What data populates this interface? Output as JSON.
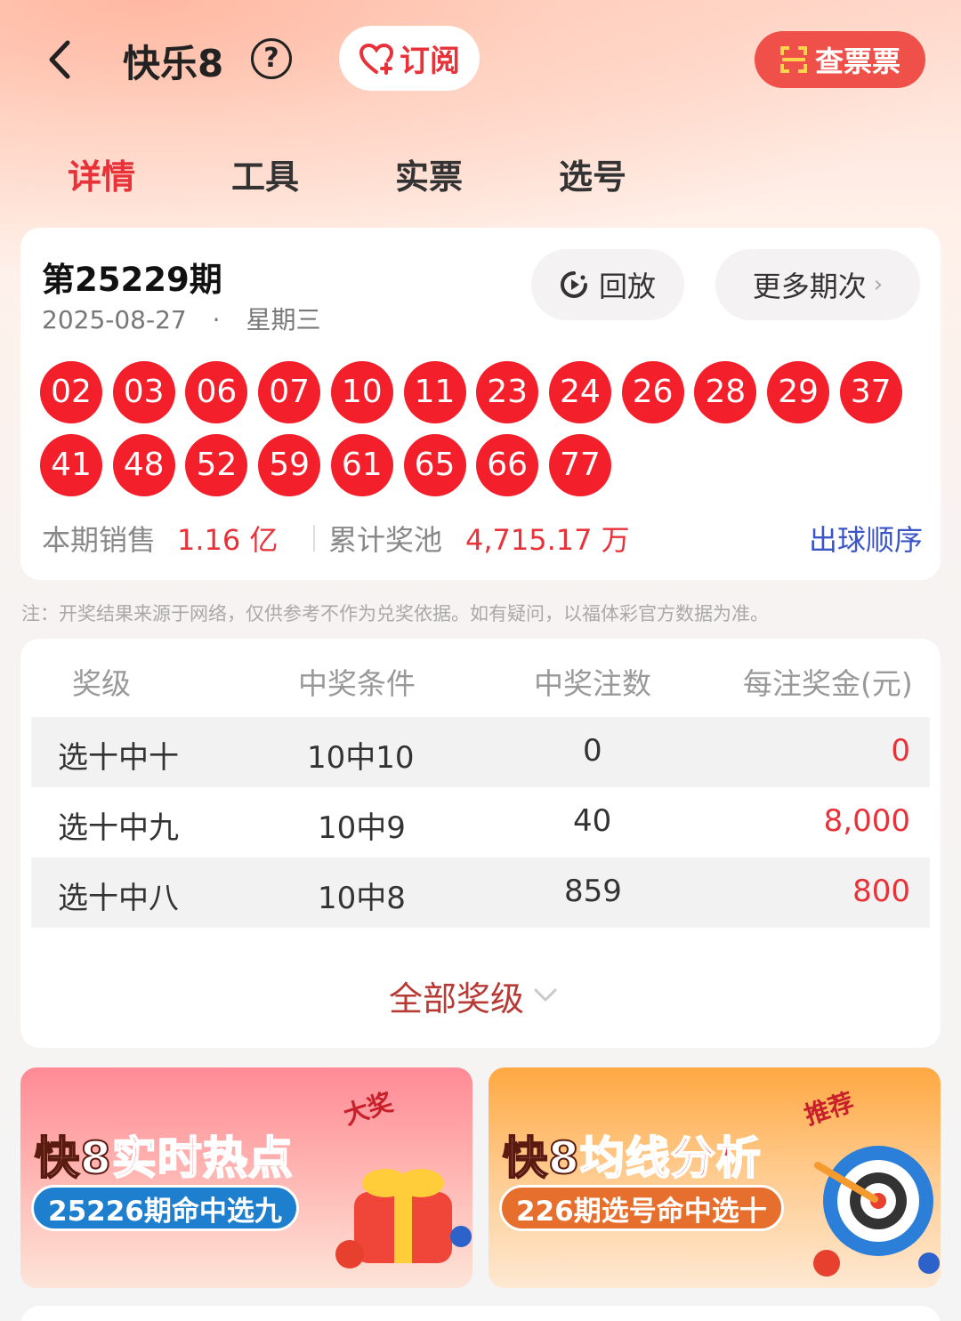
{
  "header": {
    "title": "快乐8",
    "help": "?",
    "subscribe_label": "订阅",
    "check_ticket_label": "查票票"
  },
  "tabs": [
    {
      "label": "详情",
      "active": true
    },
    {
      "label": "工具",
      "active": false
    },
    {
      "label": "实票",
      "active": false
    },
    {
      "label": "选号",
      "active": false
    }
  ],
  "draw": {
    "issue": "第25229期",
    "date": "2025-08-27",
    "separator": "·",
    "weekday": "星期三",
    "replay_label": "回放",
    "more_label": "更多期次",
    "numbers": [
      "02",
      "03",
      "06",
      "07",
      "10",
      "11",
      "23",
      "24",
      "26",
      "28",
      "29",
      "37",
      "41",
      "48",
      "52",
      "59",
      "61",
      "65",
      "66",
      "77"
    ],
    "sales_label": "本期销售",
    "sales_value": "1.16 亿",
    "pool_label": "累计奖池",
    "pool_value": "4,715.17 万",
    "order_link": "出球顺序"
  },
  "note": "注：开奖结果来源于网络，仅供参考不作为兑奖依据。如有疑问，以福体彩官方数据为准。",
  "prize_table": {
    "headers": [
      "奖级",
      "中奖条件",
      "中奖注数",
      "每注奖金(元)"
    ],
    "rows": [
      {
        "level": "选十中十",
        "condition": "10中10",
        "count": "0",
        "amount": "0"
      },
      {
        "level": "选十中九",
        "condition": "10中9",
        "count": "40",
        "amount": "8,000"
      },
      {
        "level": "选十中八",
        "condition": "10中8",
        "count": "859",
        "amount": "800"
      }
    ],
    "all_levels_label": "全部奖级"
  },
  "banners": [
    {
      "title_prefix": "快8",
      "title_highlight": "实时热点",
      "subtitle": "25226期命中选九",
      "badge": "大奖"
    },
    {
      "title_prefix": "快8",
      "title_highlight": "均线分析",
      "subtitle": "226期选号命中选十",
      "badge": "推荐"
    }
  ],
  "colors": {
    "accent": "#e8323a",
    "ball": "#f3202c",
    "link": "#3b55c7"
  }
}
